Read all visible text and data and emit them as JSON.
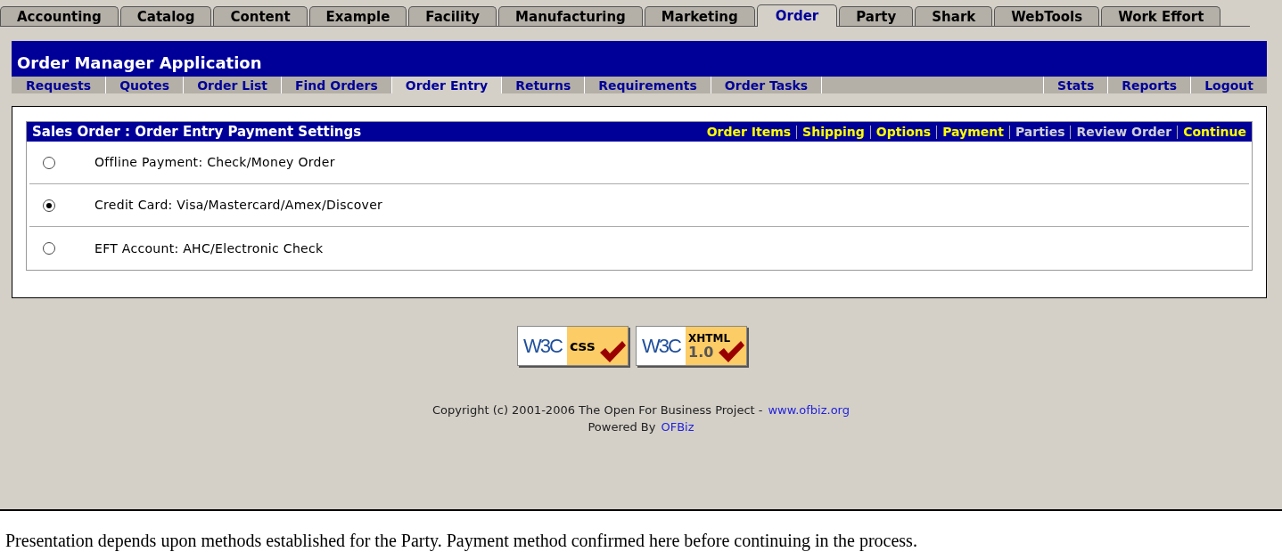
{
  "app_tabs": [
    {
      "label": "Accounting",
      "selected": false
    },
    {
      "label": "Catalog",
      "selected": false
    },
    {
      "label": "Content",
      "selected": false
    },
    {
      "label": "Example",
      "selected": false
    },
    {
      "label": "Facility",
      "selected": false
    },
    {
      "label": "Manufacturing",
      "selected": false
    },
    {
      "label": "Marketing",
      "selected": false
    },
    {
      "label": "Order",
      "selected": true
    },
    {
      "label": "Party",
      "selected": false
    },
    {
      "label": "Shark",
      "selected": false
    },
    {
      "label": "WebTools",
      "selected": false
    },
    {
      "label": "Work Effort",
      "selected": false
    }
  ],
  "app_title": "Order Manager Application",
  "nav_left": [
    {
      "label": "Requests",
      "selected": false
    },
    {
      "label": "Quotes",
      "selected": false
    },
    {
      "label": "Order List",
      "selected": false
    },
    {
      "label": "Find Orders",
      "selected": false
    },
    {
      "label": "Order Entry",
      "selected": true
    },
    {
      "label": "Returns",
      "selected": false
    },
    {
      "label": "Requirements",
      "selected": false
    },
    {
      "label": "Order Tasks",
      "selected": false
    }
  ],
  "nav_right": [
    {
      "label": "Stats",
      "selected": false
    },
    {
      "label": "Reports",
      "selected": false
    },
    {
      "label": "Logout",
      "selected": false
    }
  ],
  "panel": {
    "title": "Sales Order : Order Entry Payment Settings",
    "steps": [
      {
        "label": "Order Items",
        "disabled": false
      },
      {
        "label": "Shipping",
        "disabled": false
      },
      {
        "label": "Options",
        "disabled": false
      },
      {
        "label": "Payment",
        "disabled": false
      },
      {
        "label": "Parties",
        "disabled": true
      },
      {
        "label": "Review Order",
        "disabled": true
      },
      {
        "label": "Continue",
        "disabled": false
      }
    ],
    "options": [
      {
        "label": "Offline Payment: Check/Money Order",
        "selected": false
      },
      {
        "label": "Credit Card: Visa/Mastercard/Amex/Discover",
        "selected": true
      },
      {
        "label": "EFT Account: AHC/Electronic Check",
        "selected": false
      }
    ]
  },
  "badges": [
    {
      "mark": "W3C",
      "text": "css"
    },
    {
      "mark": "W3C",
      "text": "XHTML",
      "version": "1.0"
    }
  ],
  "footer": {
    "copyright": "Copyright (c) 2001-2006 The Open For Business Project -",
    "copyright_link": "www.ofbiz.org",
    "powered": "Powered By",
    "powered_link": "OFBiz"
  },
  "caption": "Presentation depends upon methods established for the Party. Payment method confirmed here before continuing in the process."
}
